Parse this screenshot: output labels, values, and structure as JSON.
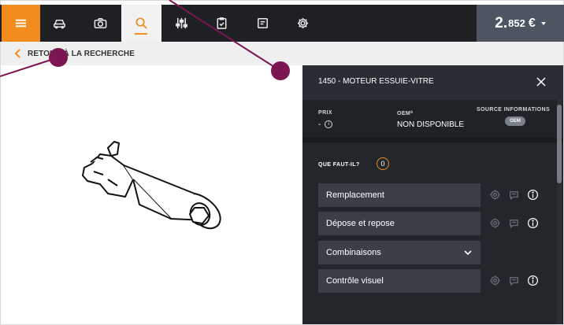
{
  "topbar": {
    "menu_icon": "hamburger-icon",
    "nav": [
      {
        "name": "car-icon"
      },
      {
        "name": "camera-icon"
      },
      {
        "name": "search-icon",
        "active": true
      },
      {
        "name": "sliders-icon"
      },
      {
        "name": "clipboard-icon"
      },
      {
        "name": "document-icon"
      },
      {
        "name": "gear-icon"
      }
    ],
    "price": {
      "integer": "2.",
      "decimal": "852",
      "currency": "€"
    }
  },
  "back": {
    "label": "RETOUR À LA RECHERCHE"
  },
  "panel": {
    "title": "1450 - MOTEUR ESSUIE-VITRE",
    "prix_label": "PRIX",
    "prix_value": "-",
    "oem_label": "OEM⁰",
    "oem_value": "NON DISPONIBLE",
    "source_label": "SOURCE INFORMATIONS",
    "source_badge": "OEM",
    "question_label": "QUE FAUT-IL?",
    "question_count": "0",
    "actions": [
      {
        "label": "Remplacement"
      },
      {
        "label": "Dépose et repose"
      },
      {
        "label": "Combinaisons"
      },
      {
        "label": "Contrôle visuel"
      }
    ]
  },
  "colors": {
    "accent": "#f28c1e",
    "topbar": "#1e2024",
    "panel": "#23262b",
    "annotation": "#7b1650"
  }
}
